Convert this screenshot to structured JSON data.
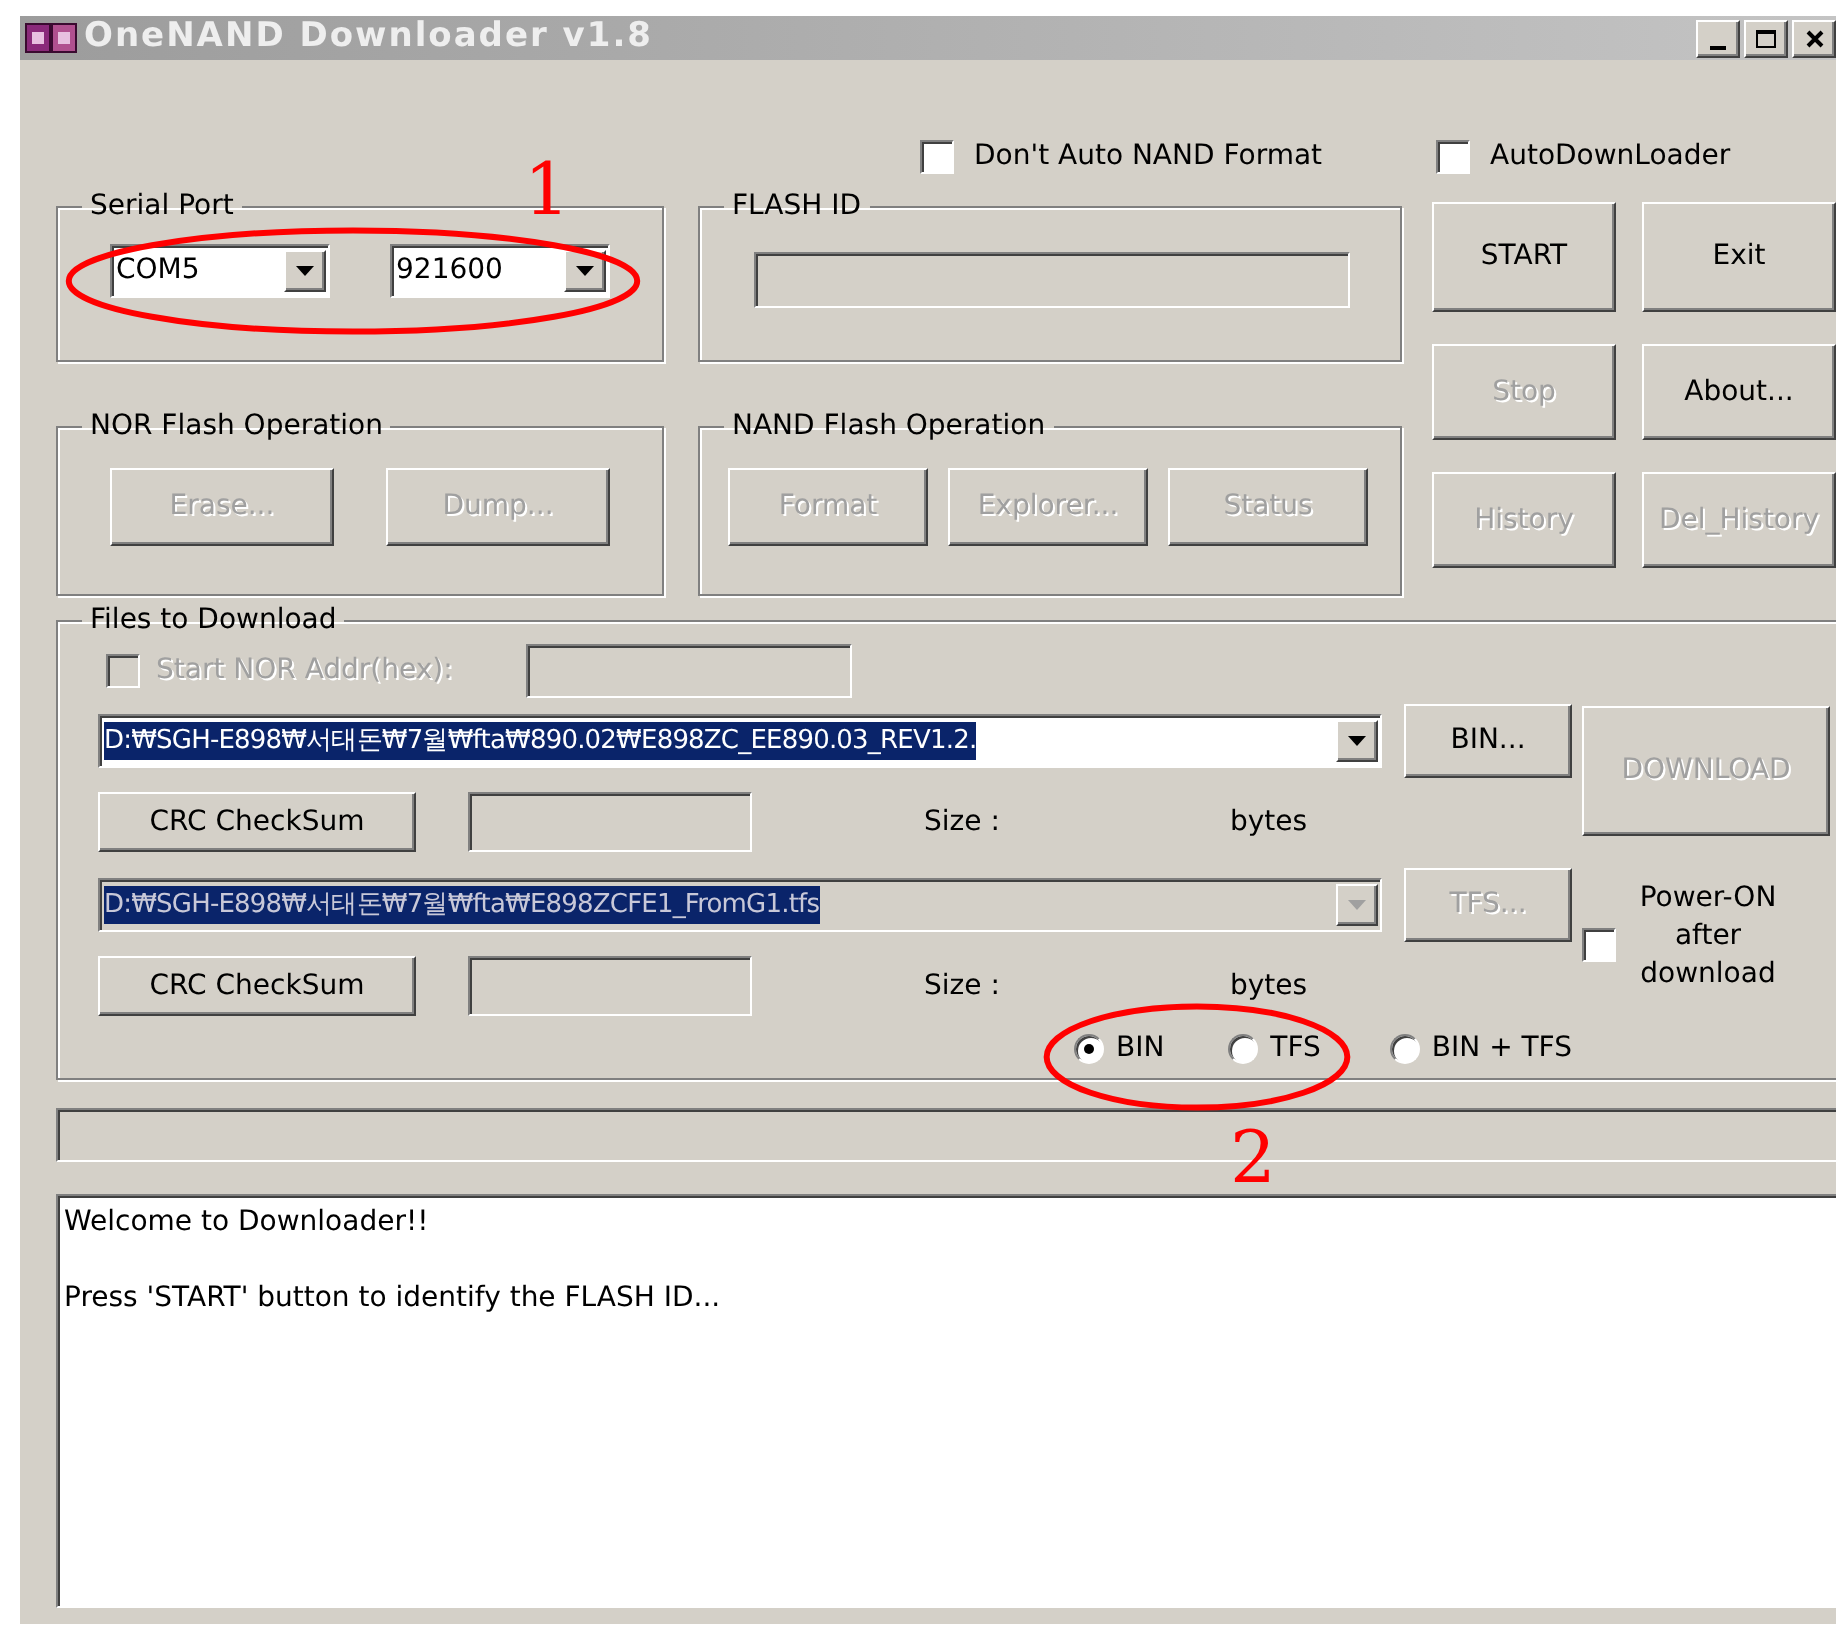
{
  "window": {
    "title": "OneNAND Downloader v1.8"
  },
  "options": [
    {
      "label": "Don't Auto NAND Format",
      "checked": false
    },
    {
      "label": "AutoDownLoader",
      "checked": false
    }
  ],
  "serial_port": {
    "title": "Serial Port",
    "port": "COM5",
    "baud": "921600"
  },
  "flash_id": {
    "title": "FLASH ID"
  },
  "side_buttons": [
    {
      "label": "START",
      "disabled": false
    },
    {
      "label": "Exit",
      "disabled": false
    },
    {
      "label": "Stop",
      "disabled": true
    },
    {
      "label": "About...",
      "disabled": false
    },
    {
      "label": "History",
      "disabled": true
    },
    {
      "label": "Del_History",
      "disabled": true
    }
  ],
  "nor": {
    "title": "NOR Flash Operation",
    "buttons": [
      {
        "label": "Erase...",
        "disabled": true
      },
      {
        "label": "Dump...",
        "disabled": true
      }
    ]
  },
  "nand": {
    "title": "NAND Flash Operation",
    "buttons": [
      {
        "label": "Format",
        "disabled": true
      },
      {
        "label": "Explorer...",
        "disabled": true
      },
      {
        "label": "Status",
        "disabled": true
      }
    ]
  },
  "files": {
    "title": "Files to Download",
    "start_nor": {
      "label": "Start NOR Addr(hex):",
      "checked": false,
      "disabled": true
    },
    "entries": [
      {
        "path": "D:₩SGH-E898₩서태돈₩7월₩fta₩890.02₩E898ZC_EE890.03_REV1.2.",
        "disabled": false,
        "browse": "BIN...",
        "crc": "CRC CheckSum",
        "size_label": "Size :",
        "unit": "bytes"
      },
      {
        "path": "D:₩SGH-E898₩서태돈₩7월₩fta₩E898ZCFE1_FromG1.tfs",
        "disabled": true,
        "browse": "TFS...",
        "crc": "CRC CheckSum",
        "size_label": "Size :",
        "unit": "bytes"
      }
    ],
    "download": {
      "label": "DOWNLOAD",
      "disabled": true
    },
    "power_on": {
      "label": "Power-ON after download",
      "checked": false
    },
    "modes": [
      {
        "label": "BIN",
        "selected": true
      },
      {
        "label": "TFS",
        "selected": false
      },
      {
        "label": "BIN + TFS",
        "selected": false
      }
    ]
  },
  "log": [
    "Welcome to Downloader!!",
    "Press 'START' button to identify the FLASH ID..."
  ],
  "annotations": [
    {
      "label": "1"
    },
    {
      "label": "2"
    }
  ]
}
